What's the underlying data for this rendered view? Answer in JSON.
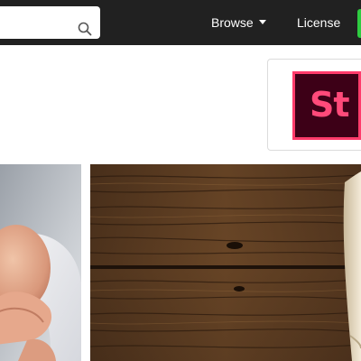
{
  "navbar": {
    "search": {
      "value": "",
      "placeholder": ""
    },
    "browse_label": "Browse",
    "license_label": "License"
  },
  "promo": {
    "logo_text": "St"
  },
  "colors": {
    "navbar_bg": "#212121",
    "stock_logo_bg": "#3d0017",
    "stock_logo_accent": "#ff3b6b",
    "nav_green": "#2ecc40"
  },
  "gallery": {
    "items": [
      {
        "subject": "baby-photo"
      },
      {
        "subject": "wood-planks-photo"
      }
    ]
  }
}
